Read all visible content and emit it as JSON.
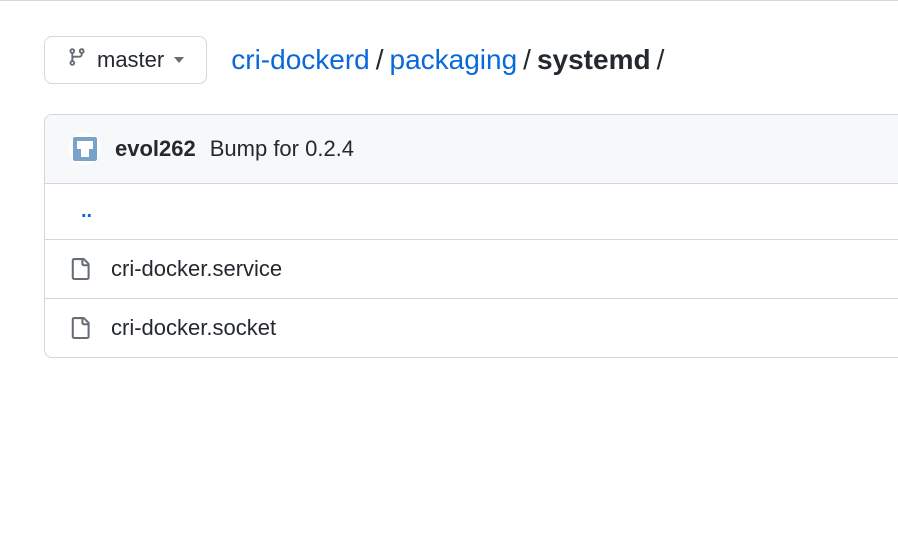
{
  "branch": {
    "name": "master"
  },
  "breadcrumb": {
    "parts": [
      {
        "label": "cri-dockerd",
        "link": true
      },
      {
        "label": "packaging",
        "link": true
      },
      {
        "label": "systemd",
        "link": false
      }
    ]
  },
  "commit": {
    "author": "evol262",
    "message": "Bump for 0.2.4"
  },
  "parent_dir": "..",
  "files": [
    {
      "name": "cri-docker.service"
    },
    {
      "name": "cri-docker.socket"
    }
  ]
}
